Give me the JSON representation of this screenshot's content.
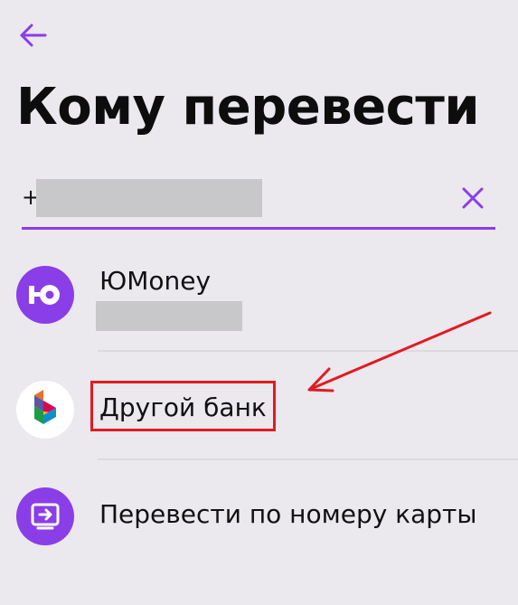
{
  "header": {
    "back_icon": "arrow-left-icon",
    "title": "Кому перевести"
  },
  "search": {
    "prefix": "+",
    "value": "",
    "clear_icon": "close-icon"
  },
  "recipients": [
    {
      "label": "ЮMoney",
      "icon": "yoomoney-logo-icon"
    },
    {
      "label": "Другой банк",
      "icon": "sbp-logo-icon"
    },
    {
      "label": "Перевести по номеру карты",
      "icon": "card-transfer-icon"
    }
  ],
  "colors": {
    "accent": "#8a3ee8",
    "background": "#ebe8ee",
    "annotation": "#e01b22"
  }
}
